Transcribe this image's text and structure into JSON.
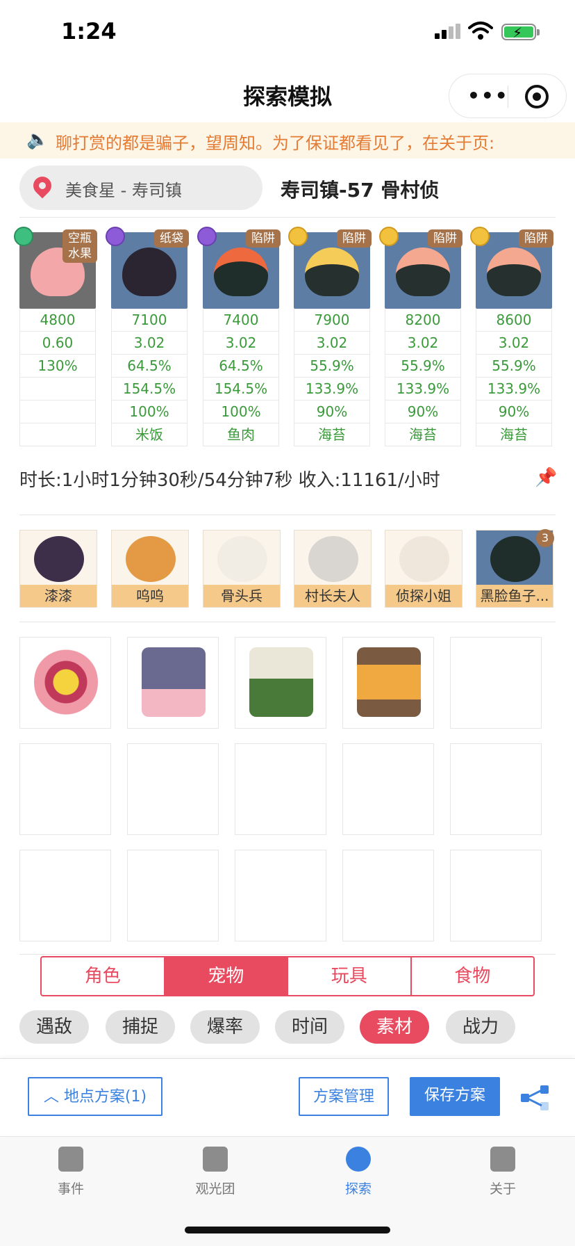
{
  "status": {
    "time": "1:24"
  },
  "nav": {
    "title": "探索模拟"
  },
  "notice": {
    "text": "聊打赏的都是骗子，望周知。为了保证都看见了，在关于页:"
  },
  "location": {
    "pill": "美食星 - 寿司镇",
    "name": "寿司镇-57 骨村侦"
  },
  "enemies": [
    {
      "tag": "空瓶\n水果",
      "tier": "green",
      "stats": [
        "4800",
        "0.60",
        "130%",
        "",
        "",
        ""
      ]
    },
    {
      "tag": "纸袋",
      "tier": "purple",
      "stats": [
        "7100",
        "3.02",
        "64.5%",
        "154.5%",
        "100%",
        "米饭"
      ]
    },
    {
      "tag": "陷阱",
      "tier": "purple",
      "stats": [
        "7400",
        "3.02",
        "64.5%",
        "154.5%",
        "100%",
        "鱼肉"
      ]
    },
    {
      "tag": "陷阱",
      "tier": "gold",
      "stats": [
        "7900",
        "3.02",
        "55.9%",
        "133.9%",
        "90%",
        "海苔"
      ]
    },
    {
      "tag": "陷阱",
      "tier": "gold",
      "stats": [
        "8200",
        "3.02",
        "55.9%",
        "133.9%",
        "90%",
        "海苔"
      ]
    },
    {
      "tag": "陷阱",
      "tier": "gold",
      "stats": [
        "8600",
        "3.02",
        "55.9%",
        "133.9%",
        "90%",
        "海苔"
      ]
    }
  ],
  "summary": {
    "duration": "时长:1小时1分钟30秒/54分钟7秒 收入:11161/小时"
  },
  "pets": [
    {
      "label": "漆漆"
    },
    {
      "label": "呜呜"
    },
    {
      "label": "骨头兵"
    },
    {
      "label": "村长夫人"
    },
    {
      "label": "侦探小姐"
    },
    {
      "label": "黑脸鱼子...",
      "badge": "3"
    }
  ],
  "category_tabs": [
    "角色",
    "宠物",
    "玩具",
    "食物"
  ],
  "filter_chips": [
    "遇敌",
    "捕捉",
    "爆率",
    "时间",
    "素材",
    "战力"
  ],
  "actions": {
    "location_plan": "地点方案(1)",
    "manage": "方案管理",
    "save": "保存方案"
  },
  "tabbar": [
    "事件",
    "观光团",
    "探索",
    "关于"
  ],
  "colors": {
    "accent": "#e84a5f",
    "primary": "#3b82e0",
    "stat_green": "#3a9a3a"
  }
}
